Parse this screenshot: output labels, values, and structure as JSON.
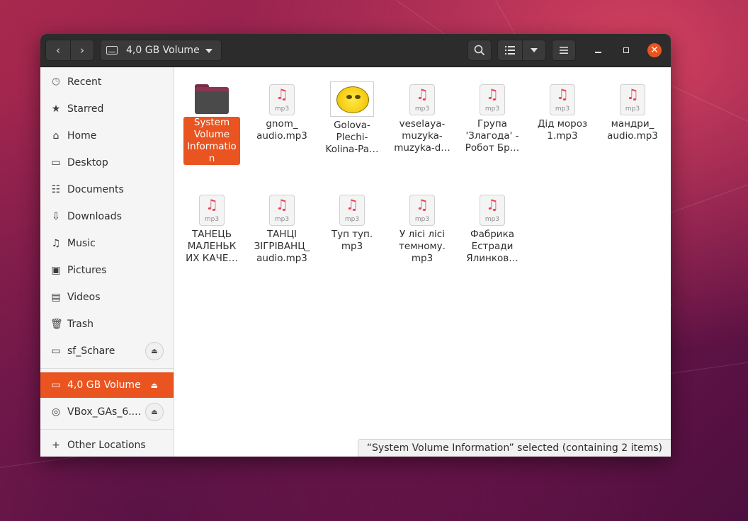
{
  "header": {
    "back_icon": "chevron-left-icon",
    "forward_icon": "chevron-right-icon",
    "location_label": "4,0 GB Volume",
    "search_icon": "search-icon",
    "view_icon": "list-view-icon",
    "menu_icon": "hamburger-menu-icon"
  },
  "sidebar": {
    "items": [
      {
        "label": "Recent",
        "icon": "clock-icon"
      },
      {
        "label": "Starred",
        "icon": "star-icon"
      },
      {
        "label": "Home",
        "icon": "home-icon"
      },
      {
        "label": "Desktop",
        "icon": "desktop-icon"
      },
      {
        "label": "Documents",
        "icon": "document-icon"
      },
      {
        "label": "Downloads",
        "icon": "download-icon"
      },
      {
        "label": "Music",
        "icon": "music-icon"
      },
      {
        "label": "Pictures",
        "icon": "picture-icon"
      },
      {
        "label": "Videos",
        "icon": "video-icon"
      },
      {
        "label": "Trash",
        "icon": "trash-icon"
      },
      {
        "label": "sf_Schare",
        "icon": "drive-icon"
      }
    ],
    "devices": [
      {
        "label": "4,0 GB Volume",
        "icon": "drive-icon",
        "active": true
      },
      {
        "label": "VBox_GAs_6....",
        "icon": "disc-icon"
      }
    ],
    "other_locations": {
      "label": "Other Locations",
      "icon": "plus-icon"
    }
  },
  "files": [
    {
      "name": "System Volume Informatio n",
      "type": "folder",
      "selected": true
    },
    {
      "name": "gnom_ audio.mp3",
      "type": "mp3"
    },
    {
      "name": "Golova-Plechi-Kolina-Pa…",
      "type": "image"
    },
    {
      "name": "veselaya-muzyka-muzyka-d…",
      "type": "mp3"
    },
    {
      "name": "Група 'Злагода' - Робот Бр…",
      "type": "mp3"
    },
    {
      "name": "Дід мороз 1.mp3",
      "type": "mp3"
    },
    {
      "name": "мандри_ audio.mp3",
      "type": "mp3"
    },
    {
      "name": "ТАНЕЦЬ МАЛЕНЬК ИХ КАЧЕ…",
      "type": "mp3"
    },
    {
      "name": "ТАНЦІ ЗІГРІВАНЦ_ audio.mp3",
      "type": "mp3"
    },
    {
      "name": "Туп туп. mp3",
      "type": "mp3"
    },
    {
      "name": "У лісі лісі темному. mp3",
      "type": "mp3"
    },
    {
      "name": "Фабрика Естради Ялинков…",
      "type": "mp3"
    }
  ],
  "mp3_ext_label": "mp3",
  "status": "“System Volume Information” selected  (containing 2 items)",
  "colors": {
    "accent": "#e95420",
    "headerbar": "#2c2c2c"
  }
}
